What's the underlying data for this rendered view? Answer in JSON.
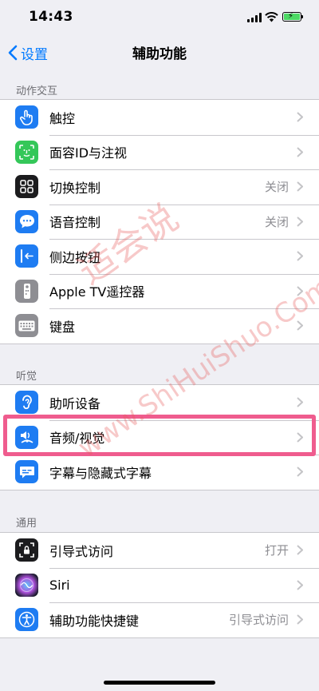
{
  "status_bar": {
    "time": "14:43"
  },
  "nav": {
    "back_label": "设置",
    "title": "辅助功能"
  },
  "sections": {
    "interaction": {
      "header": "动作交互",
      "rows": [
        {
          "label": "触控",
          "value": "",
          "icon": "touch-icon",
          "color": "#1e7cf2"
        },
        {
          "label": "面容ID与注视",
          "value": "",
          "icon": "face-id-icon",
          "color": "#34c759"
        },
        {
          "label": "切换控制",
          "value": "关闭",
          "icon": "switch-control-icon",
          "color": "#1c1c1e"
        },
        {
          "label": "语音控制",
          "value": "关闭",
          "icon": "voice-control-icon",
          "color": "#1e7cf2"
        },
        {
          "label": "侧边按钮",
          "value": "",
          "icon": "side-button-icon",
          "color": "#1e7cf2"
        },
        {
          "label": "Apple TV遥控器",
          "value": "",
          "icon": "tv-remote-icon",
          "color": "#8e8e93"
        },
        {
          "label": "键盘",
          "value": "",
          "icon": "keyboard-icon",
          "color": "#8e8e93"
        }
      ]
    },
    "hearing": {
      "header": "听觉",
      "rows": [
        {
          "label": "助听设备",
          "value": "",
          "icon": "ear-icon",
          "color": "#1e7cf2"
        },
        {
          "label": "音频/视觉",
          "value": "",
          "icon": "audio-visual-icon",
          "color": "#1e7cf2"
        },
        {
          "label": "字幕与隐藏式字幕",
          "value": "",
          "icon": "subtitles-icon",
          "color": "#1e7cf2"
        }
      ]
    },
    "general": {
      "header": "通用",
      "rows": [
        {
          "label": "引导式访问",
          "value": "打开",
          "icon": "guided-access-icon",
          "color": "#1c1c1e"
        },
        {
          "label": "Siri",
          "value": "",
          "icon": "siri-icon",
          "color": "#2b2b40"
        },
        {
          "label": "辅助功能快捷键",
          "value": "引导式访问",
          "icon": "accessibility-icon",
          "color": "#1e7cf2"
        }
      ]
    }
  },
  "watermark": {
    "chinese": "适会说",
    "latin": "www.ShiHuiShuo.Com"
  }
}
